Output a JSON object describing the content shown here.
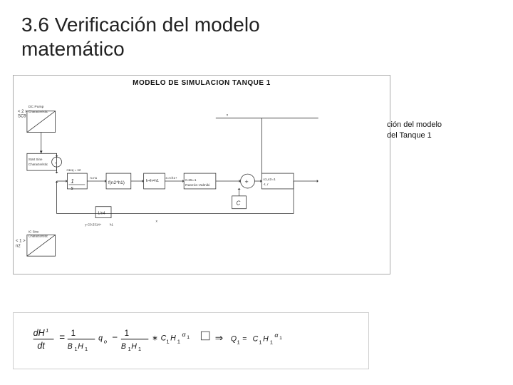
{
  "page": {
    "title_line1": "3.6 Verificación del modelo",
    "title_line2": "matemático",
    "diagram": {
      "title": "MODELO DE SIMULACION TANQUE 1",
      "caption_line1": "ción del modelo",
      "caption_line2": "del Tanque 1"
    },
    "formula": {
      "lhs": "dH₁/dt",
      "equals": "=",
      "term1_num": "1",
      "term1_den": "B₁H₁",
      "term1_var": "q_o",
      "minus": "−",
      "term2_num": "1",
      "term2_den": "B₁H₁",
      "term2_var": "* C₁H₁^α₁",
      "implies": "⇒",
      "result": "Q₁ = C₁H₁^α₁"
    }
  }
}
